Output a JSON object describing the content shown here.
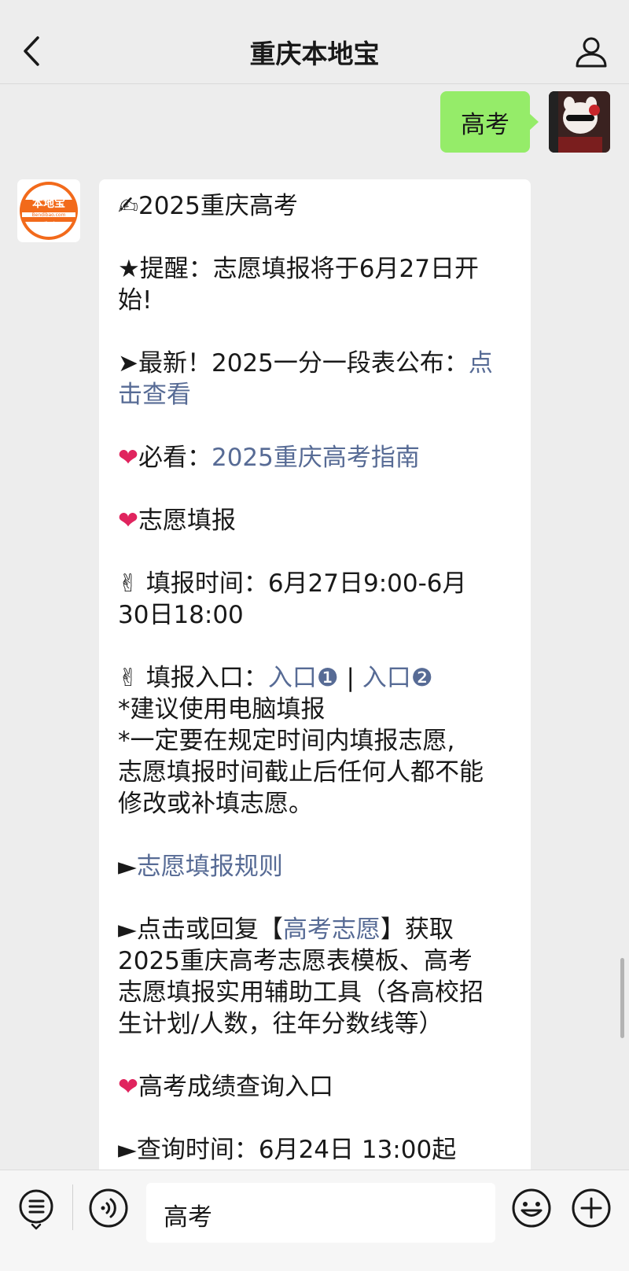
{
  "header": {
    "title": "重庆本地宝"
  },
  "outgoing": {
    "text": "高考"
  },
  "bot_avatar": {
    "line1": "本地宝",
    "line2": "Bendibao.com",
    "line3": "重庆"
  },
  "message": {
    "l1_emoji": "✍",
    "l1_text": "2025重庆高考",
    "l2": "★提醒：志愿填报将于6月27日开",
    "l3": "始!",
    "l4_prefix": "➤最新！2025一分一段表公布：",
    "l4_link_a": "点",
    "l5_link_b": "击查看",
    "l6_emoji": "❤",
    "l6_prefix": "必看：",
    "l6_link": "2025重庆高考指南",
    "l7_emoji": "❤",
    "l7_text": "志愿填报",
    "l8_emoji": "✌",
    "l8_text": " 填报时间：6月27日9:00-6月",
    "l9": "30日18:00",
    "l10_emoji": "✌",
    "l10_prefix": " 填报入口：",
    "l10_link1": "入口❶",
    "l10_sep": " | ",
    "l10_link2": "入口❷",
    "l11": "*建议使用电脑填报",
    "l12": "*一定要在规定时间内填报志愿,",
    "l13": "志愿填报时间截止后任何人都不能",
    "l14": "修改或补填志愿。",
    "l15_prefix": "►",
    "l15_link": "志愿填报规则",
    "l16_prefix": "►点击或回复【",
    "l16_link": "高考志愿",
    "l16_suffix": "】获取",
    "l17": "2025重庆高考志愿表模板、高考",
    "l18": "志愿填报实用辅助工具（各高校招",
    "l19": "生计划/人数，往年分数线等）",
    "l20_emoji": "❤",
    "l20_text": "高考成绩查询入口",
    "l21": "►查询时间：6月24日 13:00起"
  },
  "input": {
    "value": "高考"
  },
  "colors": {
    "bubble_out": "#95ec69",
    "link": "#576b95",
    "background": "#ededed",
    "brand_orange": "#f26a1b"
  }
}
